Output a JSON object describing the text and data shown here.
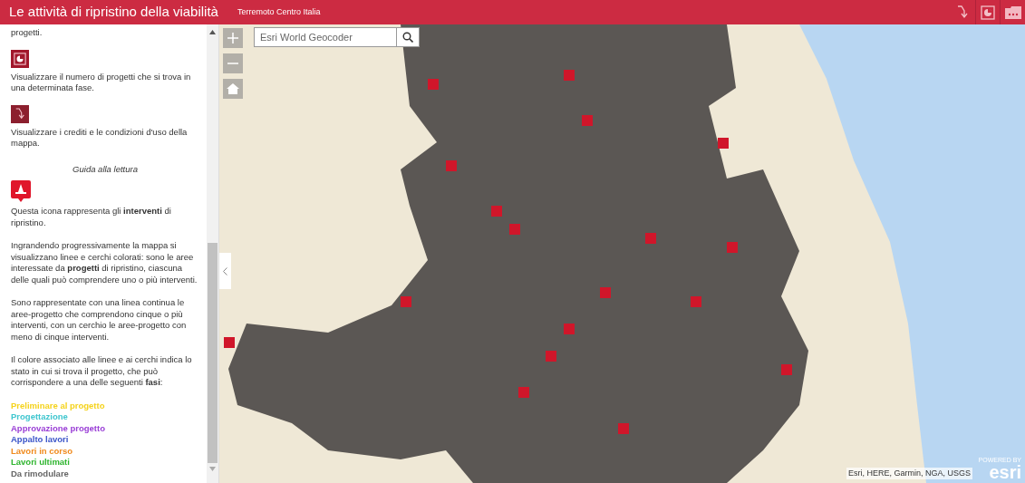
{
  "header": {
    "title": "Le attività di ripristino della viabilità",
    "subtitle": "Terremoto Centro Italia"
  },
  "sidebar": {
    "blocks": [
      {
        "kind": "text",
        "text": "progetti."
      },
      {
        "kind": "chart"
      },
      {
        "kind": "text",
        "text": "Visualizzare il numero di progetti che si trova in una determinata fase."
      },
      {
        "kind": "credits"
      },
      {
        "kind": "text",
        "text": "Visualizzare i crediti e le condizioni d'uso della mappa."
      },
      {
        "kind": "caption",
        "text": "Guida alla lettura"
      },
      {
        "kind": "marker"
      },
      {
        "kind": "text",
        "text": "Questa icona rappresenta gli **interventi** di ripristino."
      },
      {
        "kind": "text",
        "text": "Ingrandendo progressivamente la mappa si visualizzano linee e cerchi colorati: sono le aree interessate da **progetti** di ripristino, ciascuna delle quali può comprendere uno o più interventi."
      },
      {
        "kind": "text",
        "text": "Sono rappresentate con una linea continua le aree-progetto che comprendono cinque o più interventi, con un cerchio le aree-progetto con meno di cinque interventi."
      },
      {
        "kind": "text",
        "text": "Il colore associato alle linee e ai cerchi indica lo stato in cui si trova il progetto, che può corrispondere a una delle seguenti **fasi**:"
      }
    ],
    "phases": [
      {
        "label": "Preliminare al progetto",
        "color": "#f5d31c"
      },
      {
        "label": "Progettazione",
        "color": "#3fc6cf"
      },
      {
        "label": "Approvazione progetto",
        "color": "#9a3fd6"
      },
      {
        "label": "Appalto lavori",
        "color": "#3b55c9"
      },
      {
        "label": "Lavori in corso",
        "color": "#f08a1c"
      },
      {
        "label": "Lavori ultimati",
        "color": "#2fb52f"
      },
      {
        "label": "Da rimodulare",
        "color": "#666666"
      }
    ]
  },
  "map": {
    "search": {
      "placeholder": "Esri World Geocoder"
    },
    "attribution": "Esri, HERE, Garmin, NGA, USGS",
    "logo": {
      "caption": "POWERED BY",
      "name": "esri"
    }
  }
}
